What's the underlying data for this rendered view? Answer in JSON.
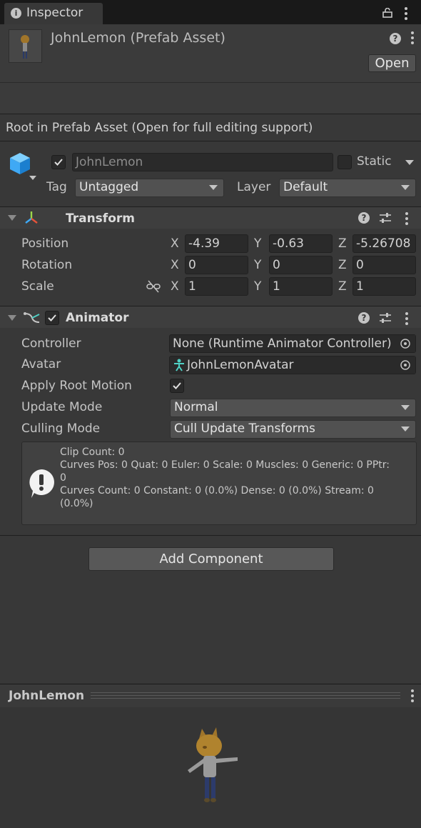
{
  "tab": {
    "title": "Inspector"
  },
  "header": {
    "asset_name": "JohnLemon (Prefab Asset)",
    "open_button": "Open",
    "info_text": "Root in Prefab Asset (Open for full editing support)"
  },
  "gameobject": {
    "name": "JohnLemon",
    "static_label": "Static",
    "tag_label": "Tag",
    "tag_value": "Untagged",
    "layer_label": "Layer",
    "layer_value": "Default"
  },
  "transform": {
    "title": "Transform",
    "rows": [
      {
        "label": "Position",
        "x": "-4.39",
        "y": "-0.63",
        "z": "-5.26708"
      },
      {
        "label": "Rotation",
        "x": "0",
        "y": "0",
        "z": "0"
      },
      {
        "label": "Scale",
        "x": "1",
        "y": "1",
        "z": "1"
      }
    ],
    "axis_x": "X",
    "axis_y": "Y",
    "axis_z": "Z"
  },
  "animator": {
    "title": "Animator",
    "controller_label": "Controller",
    "controller_value": "None (Runtime Animator Controller)",
    "avatar_label": "Avatar",
    "avatar_value": "JohnLemonAvatar",
    "apply_root_motion_label": "Apply Root Motion",
    "update_mode_label": "Update Mode",
    "update_mode_value": "Normal",
    "culling_mode_label": "Culling Mode",
    "culling_mode_value": "Cull Update Transforms",
    "info_lines": [
      "Clip Count: 0",
      "Curves Pos: 0 Quat: 0 Euler: 0 Scale: 0 Muscles: 0 Generic: 0 PPtr:",
      "0",
      "Curves Count: 0 Constant: 0 (0.0%) Dense: 0 (0.0%) Stream: 0",
      "(0.0%)"
    ]
  },
  "add_component_button": "Add Component",
  "preview": {
    "title": "JohnLemon"
  },
  "colors": {
    "background": "#383838",
    "field": "#2a2a2a",
    "header": "#3e3e3e",
    "button": "#515151",
    "accent_cube": "#3fa9f5"
  }
}
